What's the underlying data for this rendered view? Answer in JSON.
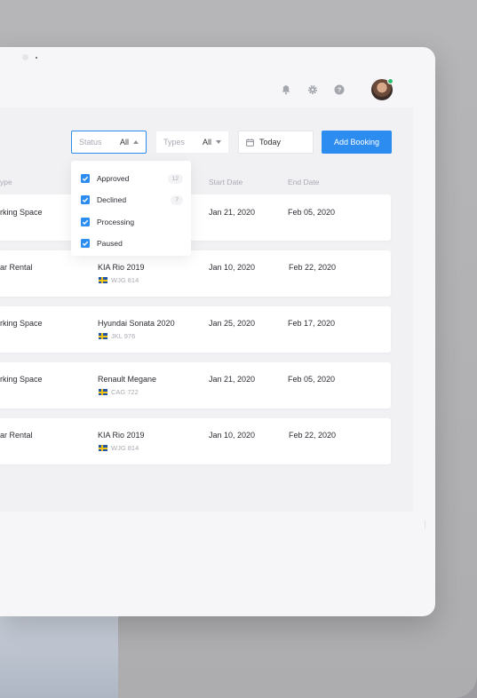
{
  "topbar": {
    "icons": [
      "bell-icon",
      "gear-icon",
      "help-icon"
    ],
    "avatar": "user-avatar"
  },
  "toolbar": {
    "status_label": "Status",
    "status_value": "All",
    "types_label": "Types",
    "types_value": "All",
    "date_value": "Today",
    "add_label": "Add Booking"
  },
  "columns": {
    "type": "ype",
    "start": "Start Date",
    "end": "End Date"
  },
  "status_menu": [
    {
      "label": "Approved",
      "checked": true,
      "count": "12"
    },
    {
      "label": "Declined",
      "checked": true,
      "count": "7"
    },
    {
      "label": "Processing",
      "checked": true,
      "count": ""
    },
    {
      "label": "Paused",
      "checked": true,
      "count": ""
    }
  ],
  "rows": [
    {
      "type": "rking Space",
      "vehicle": "",
      "plate": "",
      "start": "Jan 21, 2020",
      "end": "Feb 05, 2020"
    },
    {
      "type": "ar Rental",
      "vehicle": "KIA Rio 2019",
      "plate": "WJG 814",
      "start": "Jan 10, 2020",
      "end": "Feb 22, 2020"
    },
    {
      "type": "rking Space",
      "vehicle": "Hyundai Sonata 2020",
      "plate": "JKL 976",
      "start": "Jan 25, 2020",
      "end": "Feb 17, 2020"
    },
    {
      "type": "rking Space",
      "vehicle": "Renault Megane",
      "plate": "CAG 722",
      "start": "Jan 21, 2020",
      "end": "Feb 05, 2020"
    },
    {
      "type": "ar Rental",
      "vehicle": "KIA Rio 2019",
      "plate": "WJG 814",
      "start": "Jan 10, 2020",
      "end": "Feb 22, 2020"
    }
  ],
  "colors": {
    "accent": "#2d8cf0",
    "online": "#2fbf71"
  }
}
